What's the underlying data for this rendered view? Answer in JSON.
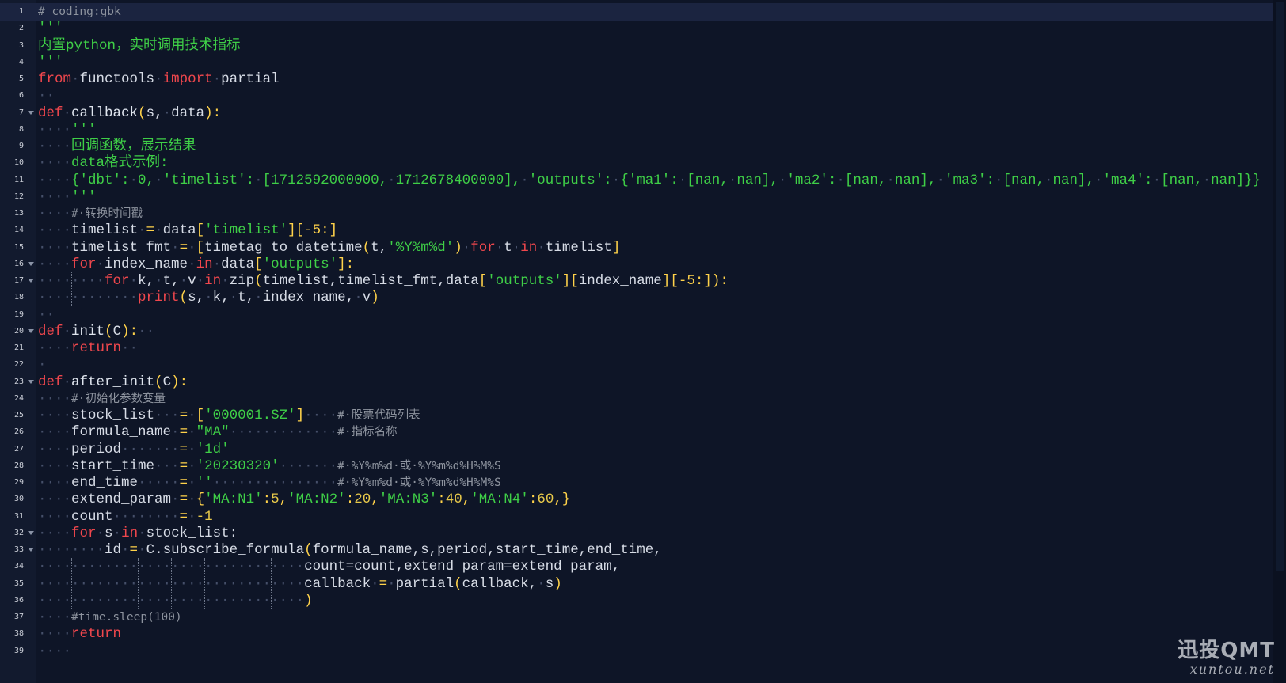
{
  "editor": {
    "lines": [
      {
        "n": "1",
        "segs": [
          [
            "cm",
            "# coding:gbk"
          ]
        ]
      },
      {
        "n": "2",
        "segs": [
          [
            "str",
            "'''"
          ]
        ]
      },
      {
        "n": "3",
        "segs": [
          [
            "str",
            "内置python，实时调用技术指标"
          ]
        ]
      },
      {
        "n": "4",
        "segs": [
          [
            "str",
            "'''"
          ]
        ]
      },
      {
        "n": "5",
        "segs": [
          [
            "kw",
            "from"
          ],
          [
            "sp",
            "·"
          ],
          [
            "var",
            "functools"
          ],
          [
            "sp",
            "·"
          ],
          [
            "kw",
            "import"
          ],
          [
            "sp",
            "·"
          ],
          [
            "var",
            "partial"
          ]
        ]
      },
      {
        "n": "6",
        "segs": [
          [
            "sp",
            "··"
          ]
        ]
      },
      {
        "n": "7",
        "fold": true,
        "segs": [
          [
            "kw",
            "def"
          ],
          [
            "sp",
            "·"
          ],
          [
            "fn",
            "callback"
          ],
          [
            "op",
            "("
          ],
          [
            "var",
            "s,"
          ],
          [
            "sp",
            "·"
          ],
          [
            "var",
            "data"
          ],
          [
            "op",
            "):"
          ]
        ]
      },
      {
        "n": "8",
        "segs": [
          [
            "sp",
            "····"
          ],
          [
            "str",
            "'''"
          ]
        ]
      },
      {
        "n": "9",
        "segs": [
          [
            "sp",
            "····"
          ],
          [
            "str",
            "回调函数，展示结果"
          ]
        ]
      },
      {
        "n": "10",
        "segs": [
          [
            "sp",
            "····"
          ],
          [
            "str",
            "data格式示例:"
          ]
        ]
      },
      {
        "n": "11",
        "segs": [
          [
            "sp",
            "····"
          ],
          [
            "str",
            "{'dbt':"
          ],
          [
            "sp",
            "·"
          ],
          [
            "str",
            "0,"
          ],
          [
            "sp",
            "·"
          ],
          [
            "str",
            "'timelist':"
          ],
          [
            "sp",
            "·"
          ],
          [
            "str",
            "[1712592000000,"
          ],
          [
            "sp",
            "·"
          ],
          [
            "str",
            "1712678400000],"
          ],
          [
            "sp",
            "·"
          ],
          [
            "str",
            "'outputs':"
          ],
          [
            "sp",
            "·"
          ],
          [
            "str",
            "{'ma1':"
          ],
          [
            "sp",
            "·"
          ],
          [
            "str",
            "[nan,"
          ],
          [
            "sp",
            "·"
          ],
          [
            "str",
            "nan],"
          ],
          [
            "sp",
            "·"
          ],
          [
            "str",
            "'ma2':"
          ],
          [
            "sp",
            "·"
          ],
          [
            "str",
            "[nan,"
          ],
          [
            "sp",
            "·"
          ],
          [
            "str",
            "nan],"
          ],
          [
            "sp",
            "·"
          ],
          [
            "str",
            "'ma3':"
          ],
          [
            "sp",
            "·"
          ],
          [
            "str",
            "[nan,"
          ],
          [
            "sp",
            "·"
          ],
          [
            "str",
            "nan],"
          ],
          [
            "sp",
            "·"
          ],
          [
            "str",
            "'ma4':"
          ],
          [
            "sp",
            "·"
          ],
          [
            "str",
            "[nan,"
          ],
          [
            "sp",
            "·"
          ],
          [
            "str",
            "nan]}}"
          ]
        ]
      },
      {
        "n": "12",
        "segs": [
          [
            "sp",
            "····"
          ],
          [
            "str",
            "'''"
          ]
        ]
      },
      {
        "n": "13",
        "segs": [
          [
            "sp",
            "····"
          ],
          [
            "cm",
            "#·转换时间戳"
          ]
        ]
      },
      {
        "n": "14",
        "segs": [
          [
            "sp",
            "····"
          ],
          [
            "var",
            "timelist"
          ],
          [
            "sp",
            "·"
          ],
          [
            "op",
            "="
          ],
          [
            "sp",
            "·"
          ],
          [
            "var",
            "data"
          ],
          [
            "op",
            "["
          ],
          [
            "str",
            "'timelist'"
          ],
          [
            "op",
            "][-5:]"
          ]
        ]
      },
      {
        "n": "15",
        "segs": [
          [
            "sp",
            "····"
          ],
          [
            "var",
            "timelist_fmt"
          ],
          [
            "sp",
            "·"
          ],
          [
            "op",
            "="
          ],
          [
            "sp",
            "·"
          ],
          [
            "op",
            "["
          ],
          [
            "var",
            "timetag_to_datetime"
          ],
          [
            "op",
            "("
          ],
          [
            "var",
            "t,"
          ],
          [
            "str",
            "'%Y%m%d'"
          ],
          [
            "op",
            ")"
          ],
          [
            "sp",
            "·"
          ],
          [
            "kw",
            "for"
          ],
          [
            "sp",
            "·"
          ],
          [
            "var",
            "t"
          ],
          [
            "sp",
            "·"
          ],
          [
            "kw",
            "in"
          ],
          [
            "sp",
            "·"
          ],
          [
            "var",
            "timelist"
          ],
          [
            "op",
            "]"
          ]
        ]
      },
      {
        "n": "16",
        "fold": true,
        "segs": [
          [
            "sp",
            "····"
          ],
          [
            "kw",
            "for"
          ],
          [
            "sp",
            "·"
          ],
          [
            "var",
            "index_name"
          ],
          [
            "sp",
            "·"
          ],
          [
            "kw",
            "in"
          ],
          [
            "sp",
            "·"
          ],
          [
            "var",
            "data"
          ],
          [
            "op",
            "["
          ],
          [
            "str",
            "'outputs'"
          ],
          [
            "op",
            "]:"
          ]
        ]
      },
      {
        "n": "17",
        "fold": true,
        "segs": [
          [
            "sp",
            "········"
          ],
          [
            "kw",
            "for"
          ],
          [
            "sp",
            "·"
          ],
          [
            "var",
            "k,"
          ],
          [
            "sp",
            "·"
          ],
          [
            "var",
            "t,"
          ],
          [
            "sp",
            "·"
          ],
          [
            "var",
            "v"
          ],
          [
            "sp",
            "·"
          ],
          [
            "kw",
            "in"
          ],
          [
            "sp",
            "·"
          ],
          [
            "var",
            "zip"
          ],
          [
            "op",
            "("
          ],
          [
            "var",
            "timelist,timelist_fmt,data"
          ],
          [
            "op",
            "["
          ],
          [
            "str",
            "'outputs'"
          ],
          [
            "op",
            "]["
          ],
          [
            "var",
            "index_name"
          ],
          [
            "op",
            "][-5:]):"
          ]
        ]
      },
      {
        "n": "18",
        "segs": [
          [
            "sp",
            "············"
          ],
          [
            "kw",
            "print"
          ],
          [
            "op",
            "("
          ],
          [
            "var",
            "s,"
          ],
          [
            "sp",
            "·"
          ],
          [
            "var",
            "k,"
          ],
          [
            "sp",
            "·"
          ],
          [
            "var",
            "t,"
          ],
          [
            "sp",
            "·"
          ],
          [
            "var",
            "index_name,"
          ],
          [
            "sp",
            "·"
          ],
          [
            "var",
            "v"
          ],
          [
            "op",
            ")"
          ]
        ]
      },
      {
        "n": "19",
        "segs": [
          [
            "sp",
            "··"
          ]
        ]
      },
      {
        "n": "20",
        "fold": true,
        "segs": [
          [
            "kw",
            "def"
          ],
          [
            "sp",
            "·"
          ],
          [
            "fn",
            "init"
          ],
          [
            "op",
            "("
          ],
          [
            "var",
            "C"
          ],
          [
            "op",
            "):"
          ],
          [
            "sp",
            "··"
          ]
        ]
      },
      {
        "n": "21",
        "segs": [
          [
            "sp",
            "····"
          ],
          [
            "kw",
            "return"
          ],
          [
            "sp",
            "··"
          ]
        ]
      },
      {
        "n": "22",
        "segs": [
          [
            "sp",
            "·"
          ]
        ]
      },
      {
        "n": "23",
        "fold": true,
        "segs": [
          [
            "kw",
            "def"
          ],
          [
            "sp",
            "·"
          ],
          [
            "fn",
            "after_init"
          ],
          [
            "op",
            "("
          ],
          [
            "var",
            "C"
          ],
          [
            "op",
            "):"
          ]
        ]
      },
      {
        "n": "24",
        "segs": [
          [
            "sp",
            "····"
          ],
          [
            "cm",
            "#·初始化参数变量"
          ]
        ]
      },
      {
        "n": "25",
        "segs": [
          [
            "sp",
            "····"
          ],
          [
            "var",
            "stock_list"
          ],
          [
            "sp",
            "···"
          ],
          [
            "op",
            "="
          ],
          [
            "sp",
            "·"
          ],
          [
            "op",
            "["
          ],
          [
            "str",
            "'000001.SZ'"
          ],
          [
            "op",
            "]"
          ],
          [
            "sp",
            "····"
          ],
          [
            "cm",
            "#·股票代码列表"
          ]
        ]
      },
      {
        "n": "26",
        "segs": [
          [
            "sp",
            "····"
          ],
          [
            "var",
            "formula_name"
          ],
          [
            "sp",
            "·"
          ],
          [
            "op",
            "="
          ],
          [
            "sp",
            "·"
          ],
          [
            "str",
            "\"MA\""
          ],
          [
            "sp",
            "·············"
          ],
          [
            "cm",
            "#·指标名称"
          ]
        ]
      },
      {
        "n": "27",
        "segs": [
          [
            "sp",
            "····"
          ],
          [
            "var",
            "period"
          ],
          [
            "sp",
            "·······"
          ],
          [
            "op",
            "="
          ],
          [
            "sp",
            "·"
          ],
          [
            "str",
            "'1d'"
          ]
        ]
      },
      {
        "n": "28",
        "segs": [
          [
            "sp",
            "····"
          ],
          [
            "var",
            "start_time"
          ],
          [
            "sp",
            "···"
          ],
          [
            "op",
            "="
          ],
          [
            "sp",
            "·"
          ],
          [
            "str",
            "'20230320'"
          ],
          [
            "sp",
            "·······"
          ],
          [
            "cm",
            "#·%Y%m%d·或·%Y%m%d%H%M%S"
          ]
        ]
      },
      {
        "n": "29",
        "segs": [
          [
            "sp",
            "····"
          ],
          [
            "var",
            "end_time"
          ],
          [
            "sp",
            "·····"
          ],
          [
            "op",
            "="
          ],
          [
            "sp",
            "·"
          ],
          [
            "str",
            "''"
          ],
          [
            "sp",
            "···············"
          ],
          [
            "cm",
            "#·%Y%m%d·或·%Y%m%d%H%M%S"
          ]
        ]
      },
      {
        "n": "30",
        "segs": [
          [
            "sp",
            "····"
          ],
          [
            "var",
            "extend_param"
          ],
          [
            "sp",
            "·"
          ],
          [
            "op",
            "="
          ],
          [
            "sp",
            "·"
          ],
          [
            "op",
            "{"
          ],
          [
            "str",
            "'MA:N1'"
          ],
          [
            "op",
            ":"
          ],
          [
            "num",
            "5"
          ],
          [
            "op",
            ","
          ],
          [
            "str",
            "'MA:N2'"
          ],
          [
            "op",
            ":"
          ],
          [
            "num",
            "20"
          ],
          [
            "op",
            ","
          ],
          [
            "str",
            "'MA:N3'"
          ],
          [
            "op",
            ":"
          ],
          [
            "num",
            "40"
          ],
          [
            "op",
            ","
          ],
          [
            "str",
            "'MA:N4'"
          ],
          [
            "op",
            ":"
          ],
          [
            "num",
            "60"
          ],
          [
            "op",
            ",}"
          ]
        ]
      },
      {
        "n": "31",
        "segs": [
          [
            "sp",
            "····"
          ],
          [
            "var",
            "count"
          ],
          [
            "sp",
            "········"
          ],
          [
            "op",
            "="
          ],
          [
            "sp",
            "·"
          ],
          [
            "num",
            "-1"
          ]
        ]
      },
      {
        "n": "32",
        "fold": true,
        "segs": [
          [
            "sp",
            "····"
          ],
          [
            "kw",
            "for"
          ],
          [
            "sp",
            "·"
          ],
          [
            "var",
            "s"
          ],
          [
            "sp",
            "·"
          ],
          [
            "kw",
            "in"
          ],
          [
            "sp",
            "·"
          ],
          [
            "var",
            "stock_list:"
          ]
        ]
      },
      {
        "n": "33",
        "fold": true,
        "segs": [
          [
            "sp",
            "········"
          ],
          [
            "var",
            "id"
          ],
          [
            "sp",
            "·"
          ],
          [
            "op",
            "="
          ],
          [
            "sp",
            "·"
          ],
          [
            "var",
            "C.subscribe_formula"
          ],
          [
            "op",
            "("
          ],
          [
            "var",
            "formula_name,s,period,start_time,end_time,"
          ]
        ]
      },
      {
        "n": "34",
        "segs": [
          [
            "sp",
            "································"
          ],
          [
            "var",
            "count=count,extend_param=extend_param,"
          ]
        ]
      },
      {
        "n": "35",
        "segs": [
          [
            "sp",
            "································"
          ],
          [
            "var",
            "callback"
          ],
          [
            "sp",
            "·"
          ],
          [
            "op",
            "="
          ],
          [
            "sp",
            "·"
          ],
          [
            "var",
            "partial"
          ],
          [
            "op",
            "("
          ],
          [
            "var",
            "callback,"
          ],
          [
            "sp",
            "·"
          ],
          [
            "var",
            "s"
          ],
          [
            "op",
            ")"
          ]
        ]
      },
      {
        "n": "36",
        "segs": [
          [
            "sp",
            "································"
          ],
          [
            "op",
            ")"
          ]
        ]
      },
      {
        "n": "37",
        "segs": [
          [
            "sp",
            "····"
          ],
          [
            "cm",
            "#time.sleep(100)"
          ]
        ]
      },
      {
        "n": "38",
        "segs": [
          [
            "sp",
            "····"
          ],
          [
            "kw",
            "return"
          ]
        ]
      },
      {
        "n": "39",
        "segs": [
          [
            "sp",
            "····"
          ]
        ]
      }
    ]
  },
  "watermark": {
    "brand": "迅投QMT",
    "site": "xuntou.net"
  }
}
